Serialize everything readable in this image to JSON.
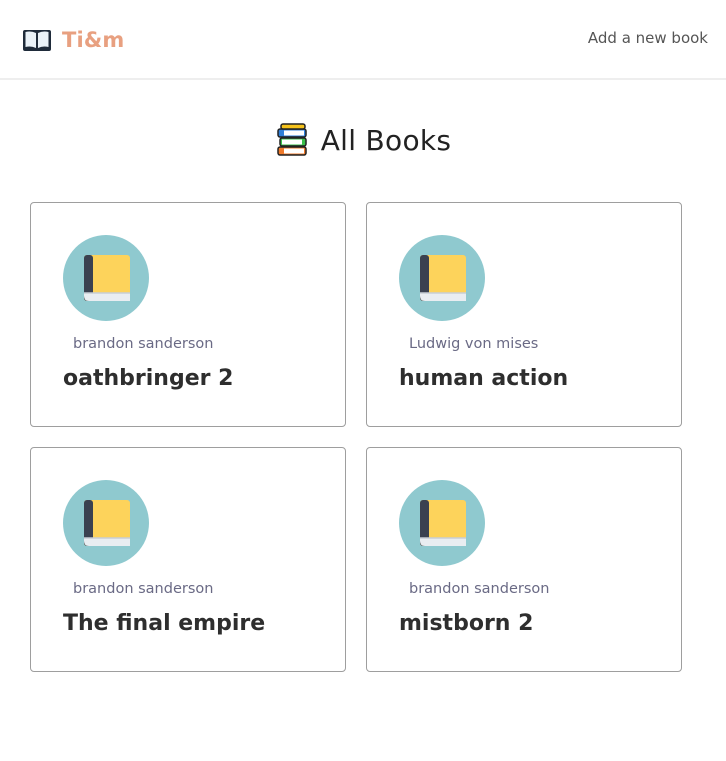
{
  "navbar": {
    "brand": "Ti&m",
    "brand_icon": "open-book-icon",
    "add_link": "Add a new book",
    "brand_color": "#e8a080"
  },
  "page": {
    "heading": "All Books",
    "heading_icon": "books-stack-icon"
  },
  "books": [
    {
      "author": "brandon sanderson",
      "title": "oathbringer 2",
      "cover_icon": "book-icon"
    },
    {
      "author": "Ludwig von mises",
      "title": "human action",
      "cover_icon": "book-icon"
    },
    {
      "author": "brandon sanderson",
      "title": "The final empire",
      "cover_icon": "book-icon"
    },
    {
      "author": "brandon sanderson",
      "title": "mistborn 2",
      "cover_icon": "book-icon"
    }
  ],
  "colors": {
    "cover_circle": "#8fc9cf",
    "book_yellow": "#fdd35b",
    "book_spine": "#3a4150"
  }
}
